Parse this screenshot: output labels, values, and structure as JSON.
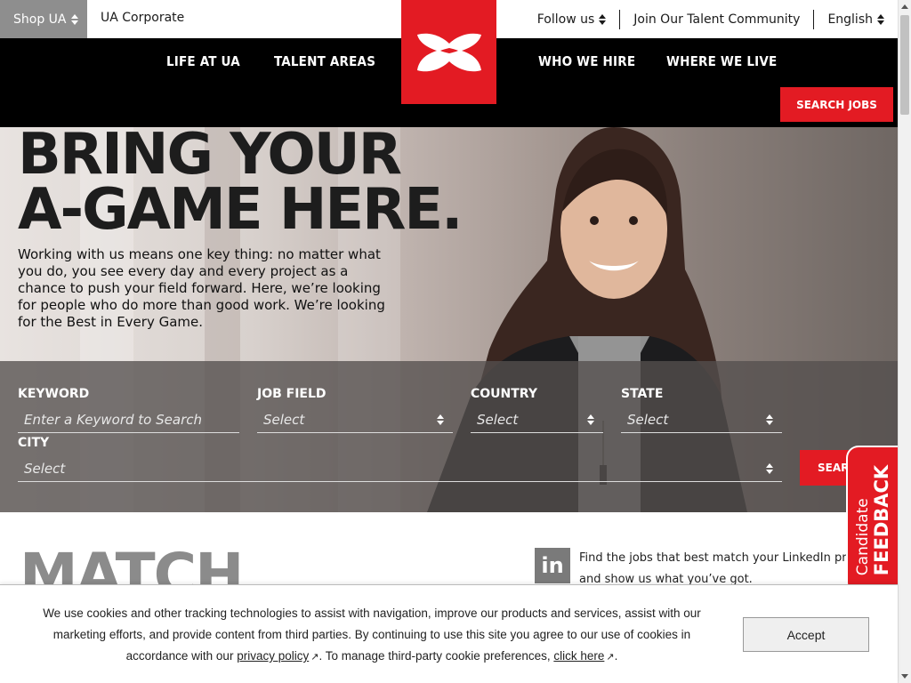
{
  "utility_bar": {
    "shop_label": "Shop UA",
    "corporate_label": "UA Corporate",
    "follow_label": "Follow us",
    "talent_label": "Join Our Talent Community",
    "language_label": "English"
  },
  "nav": {
    "items": [
      "LIFE AT UA",
      "TALENT AREAS",
      "WHO WE HIRE",
      "WHERE WE LIVE"
    ],
    "search_jobs_label": "SEARCH JOBS"
  },
  "hero": {
    "title_line1": "BRING YOUR",
    "title_line2": "A-GAME HERE.",
    "body": "Working with us means one key thing: no matter what you do, you see every day and every project as a chance to push your field forward. Here, we’re looking for people who do more than good work. We’re looking for the Best in Every Game."
  },
  "search": {
    "keyword_label": "KEYWORD",
    "keyword_placeholder": "Enter a Keyword to Search",
    "job_field_label": "JOB FIELD",
    "job_field_value": "Select",
    "country_label": "COUNTRY",
    "country_value": "Select",
    "state_label": "STATE",
    "state_value": "Select",
    "city_label": "CITY",
    "city_value": "Select",
    "button_label": "SEARCH"
  },
  "feedback": {
    "line1": "Candidate",
    "line2": "FEEDBACK"
  },
  "match": {
    "title": "MATCH",
    "linkedin_icon_text": "in",
    "linkedin_line1": "Find the jobs that best match your LinkedIn profile",
    "linkedin_line2": "and show us what you’ve got."
  },
  "cookie": {
    "text_before": "We use cookies and other tracking technologies to assist with navigation, improve our products and services, assist with our marketing efforts, and provide content from third parties. By continuing to use this site you agree to our use of cookies in accordance with our ",
    "privacy_link": "privacy policy",
    "text_middle": ". To manage third-party cookie preferences, ",
    "click_link": "click here",
    "text_after": ".",
    "accept_label": "Accept"
  },
  "colors": {
    "brand_red": "#e31b23",
    "nav_black": "#000000",
    "shop_grey": "#8e8e8e"
  }
}
